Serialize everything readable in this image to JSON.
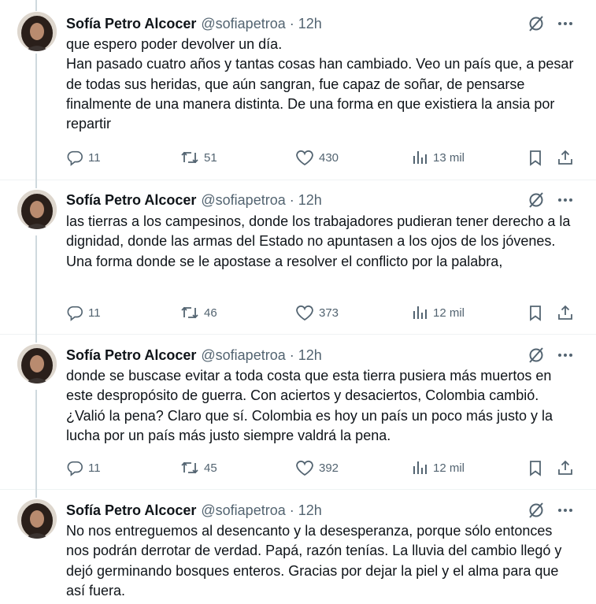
{
  "author": {
    "name": "Sofía Petro Alcocer",
    "handle": "@sofiapetroa",
    "separator": "·",
    "time": "12h"
  },
  "icons": {
    "grok": "grok-slash-circle-icon",
    "more": "more-horizontal-icon",
    "reply": "reply-icon",
    "retweet": "retweet-icon",
    "like": "heart-icon",
    "views": "views-bar-chart-icon",
    "bookmark": "bookmark-icon",
    "share": "share-icon"
  },
  "colors": {
    "text": "#0f1419",
    "secondary": "#536471",
    "thread_line": "#cfd9de",
    "divider": "#eff3f4"
  },
  "tweets": [
    {
      "paragraphs": [
        "que espero poder devolver un día.",
        "Han pasado cuatro años y tantas cosas han cambiado.  Veo un país que,  a pesar de todas sus heridas, que aún sangran, fue capaz de soñar, de pensarse finalmente de una manera distinta. De una forma en que existiera la ansia  por repartir"
      ],
      "replies": "11",
      "retweets": "51",
      "likes": "430",
      "views": "13 mil"
    },
    {
      "paragraphs": [
        "las tierras a los campesinos, donde los trabajadores pudieran tener derecho a la dignidad, donde las armas del Estado no apuntasen a los ojos de los jóvenes. Una forma  donde se le apostase a resolver el conflicto por la palabra,"
      ],
      "replies": "11",
      "retweets": "46",
      "likes": "373",
      "views": "12 mil"
    },
    {
      "paragraphs": [
        "donde se buscase evitar a toda costa que esta tierra pusiera más muertos en este despropósito de guerra. Con aciertos y desaciertos, Colombia cambió. ¿Valió la pena? Claro que sí. Colombia es hoy un país un poco más justo y la lucha por un país más justo siempre valdrá la pena."
      ],
      "replies": "11",
      "retweets": "45",
      "likes": "392",
      "views": "12 mil"
    },
    {
      "paragraphs": [
        "No nos entreguemos al desencanto y la desesperanza, porque sólo entonces nos podrán derrotar de verdad. Papá, razón tenías.  La  lluvia del cambio llegó y dejó germinando bosques enteros. Gracias por dejar la piel y el alma para que así fuera."
      ]
    }
  ]
}
